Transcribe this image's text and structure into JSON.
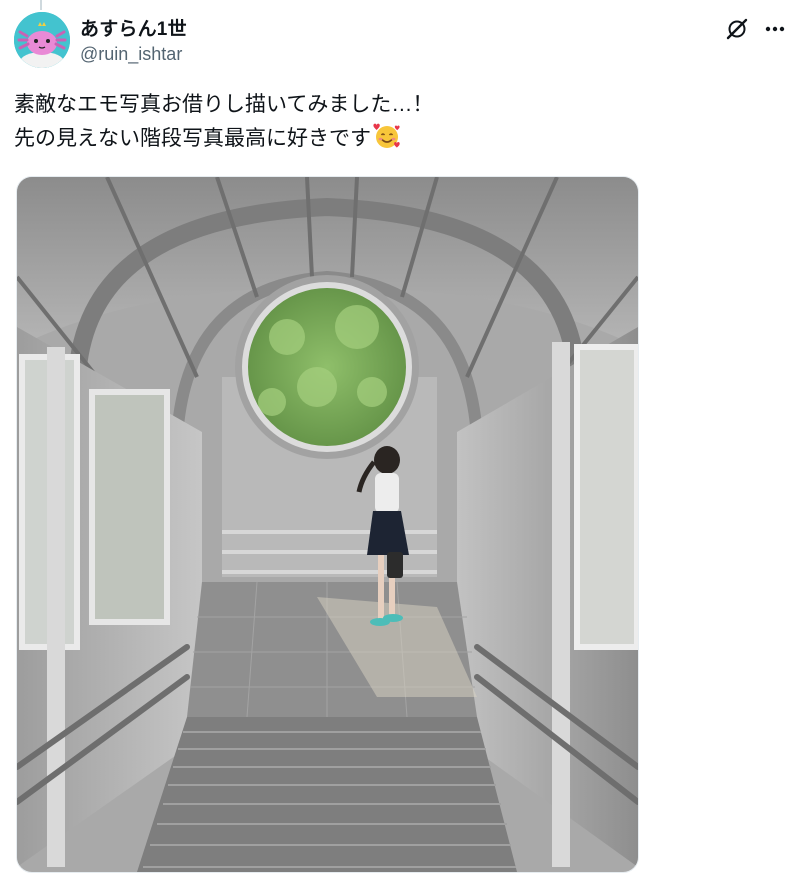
{
  "tweet": {
    "display_name": "あすらん1世",
    "handle": "@ruin_ishtar",
    "text_line1": "素敵なエモ写真お借りし描いてみました…！",
    "text_line2": "先の見えない階段写真最高に好きです",
    "emoji": "smiling-face-with-hearts"
  },
  "icons": {
    "avatar": "axolotl-avatar",
    "grok": "grok-icon",
    "more": "more-options-icon"
  },
  "colors": {
    "avatar_bg": "#43c3cf",
    "text": "#0f1419",
    "secondary_text": "#536471"
  }
}
